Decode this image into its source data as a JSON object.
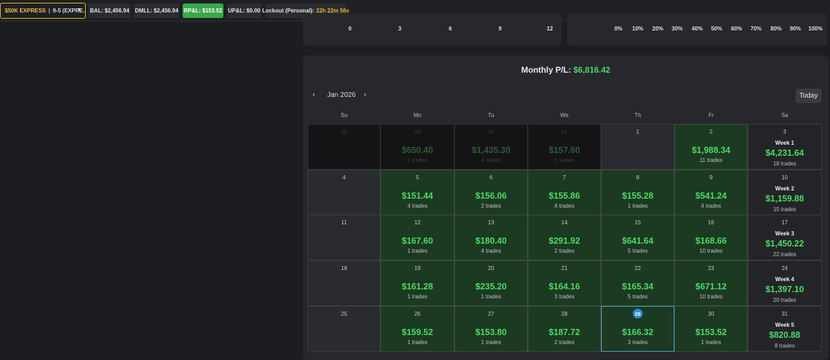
{
  "topbar": {
    "account_name": "$50K EXPRESS",
    "account_sep": "|",
    "account_type": "9-5 (EXPRE...",
    "bal": "BAL: $2,456.94",
    "dmll": "DMLL: $2,456.94",
    "rpl": "RP&L: $153.52",
    "upl": "UP&L: $0.00",
    "lockout_label": "Lockout (Personal):",
    "lockout_time": "22h 22m 56s"
  },
  "chart_left": {
    "ticks": [
      "0",
      "3",
      "6",
      "9",
      "12"
    ]
  },
  "chart_right": {
    "ticks": [
      "0%",
      "10%",
      "20%",
      "30%",
      "40%",
      "50%",
      "60%",
      "70%",
      "80%",
      "90%",
      "100%"
    ]
  },
  "calendar": {
    "title_label": "Monthly P/L:",
    "title_amount": "$6,816.42",
    "prev": "‹",
    "next": "›",
    "month": "Jan 2026",
    "today": "Today",
    "days": [
      "Su",
      "Mo",
      "Tu",
      "We",
      "Th",
      "Fr",
      "Sa"
    ],
    "weeks": [
      [
        {
          "d": "28",
          "s": "past"
        },
        {
          "d": "29",
          "s": "past",
          "a": "$650.40",
          "t": "2 trades"
        },
        {
          "d": "30",
          "s": "past",
          "a": "$1,435.30",
          "t": "4 trades"
        },
        {
          "d": "31",
          "s": "past",
          "a": "$157.60",
          "t": "1 trades"
        },
        {
          "d": "1",
          "s": "empty"
        },
        {
          "d": "2",
          "s": "green",
          "a": "$1,988.34",
          "t": "11 trades"
        },
        {
          "d": "3",
          "s": "week",
          "w": "Week 1",
          "a": "$4,231.64",
          "t": "18 trades"
        }
      ],
      [
        {
          "d": "4",
          "s": "empty"
        },
        {
          "d": "5",
          "s": "green",
          "a": "$151.44",
          "t": "4 trades"
        },
        {
          "d": "6",
          "s": "green",
          "a": "$156.06",
          "t": "2 trades"
        },
        {
          "d": "7",
          "s": "green",
          "a": "$155.86",
          "t": "4 trades"
        },
        {
          "d": "8",
          "s": "green",
          "a": "$155.28",
          "t": "1 trades"
        },
        {
          "d": "9",
          "s": "green",
          "a": "$541.24",
          "t": "4 trades"
        },
        {
          "d": "10",
          "s": "week",
          "w": "Week 2",
          "a": "$1,159.88",
          "t": "15 trades"
        }
      ],
      [
        {
          "d": "11",
          "s": "empty"
        },
        {
          "d": "12",
          "s": "green",
          "a": "$167.60",
          "t": "1 trades"
        },
        {
          "d": "13",
          "s": "green",
          "a": "$180.40",
          "t": "4 trades"
        },
        {
          "d": "14",
          "s": "green",
          "a": "$291.92",
          "t": "2 trades"
        },
        {
          "d": "15",
          "s": "green",
          "a": "$641.64",
          "t": "5 trades"
        },
        {
          "d": "16",
          "s": "green",
          "a": "$168.66",
          "t": "10 trades"
        },
        {
          "d": "17",
          "s": "week",
          "w": "Week 3",
          "a": "$1,450.22",
          "t": "22 trades"
        }
      ],
      [
        {
          "d": "18",
          "s": "empty"
        },
        {
          "d": "19",
          "s": "green",
          "a": "$161.28",
          "t": "1 trades"
        },
        {
          "d": "20",
          "s": "green",
          "a": "$235.20",
          "t": "1 trades"
        },
        {
          "d": "21",
          "s": "green",
          "a": "$164.16",
          "t": "3 trades"
        },
        {
          "d": "22",
          "s": "green",
          "a": "$165.34",
          "t": "5 trades"
        },
        {
          "d": "23",
          "s": "green",
          "a": "$671.12",
          "t": "10 trades"
        },
        {
          "d": "24",
          "s": "week",
          "w": "Week 4",
          "a": "$1,397.10",
          "t": "20 trades"
        }
      ],
      [
        {
          "d": "25",
          "s": "empty"
        },
        {
          "d": "26",
          "s": "green",
          "a": "$159.52",
          "t": "1 trades"
        },
        {
          "d": "27",
          "s": "green",
          "a": "$153.80",
          "t": "1 trades"
        },
        {
          "d": "28",
          "s": "green",
          "a": "$187.72",
          "t": "2 trades"
        },
        {
          "d": "29",
          "s": "green",
          "a": "$166.32",
          "t": "3 trades",
          "today": true
        },
        {
          "d": "30",
          "s": "green",
          "a": "$153.52",
          "t": "1 trades"
        },
        {
          "d": "31",
          "s": "week",
          "w": "Week 5",
          "a": "$820.88",
          "t": "8 trades"
        }
      ]
    ]
  },
  "colors": {
    "profit": "#4cd964",
    "accent": "#e8b72a",
    "today_ring": "#4aa3c8"
  }
}
